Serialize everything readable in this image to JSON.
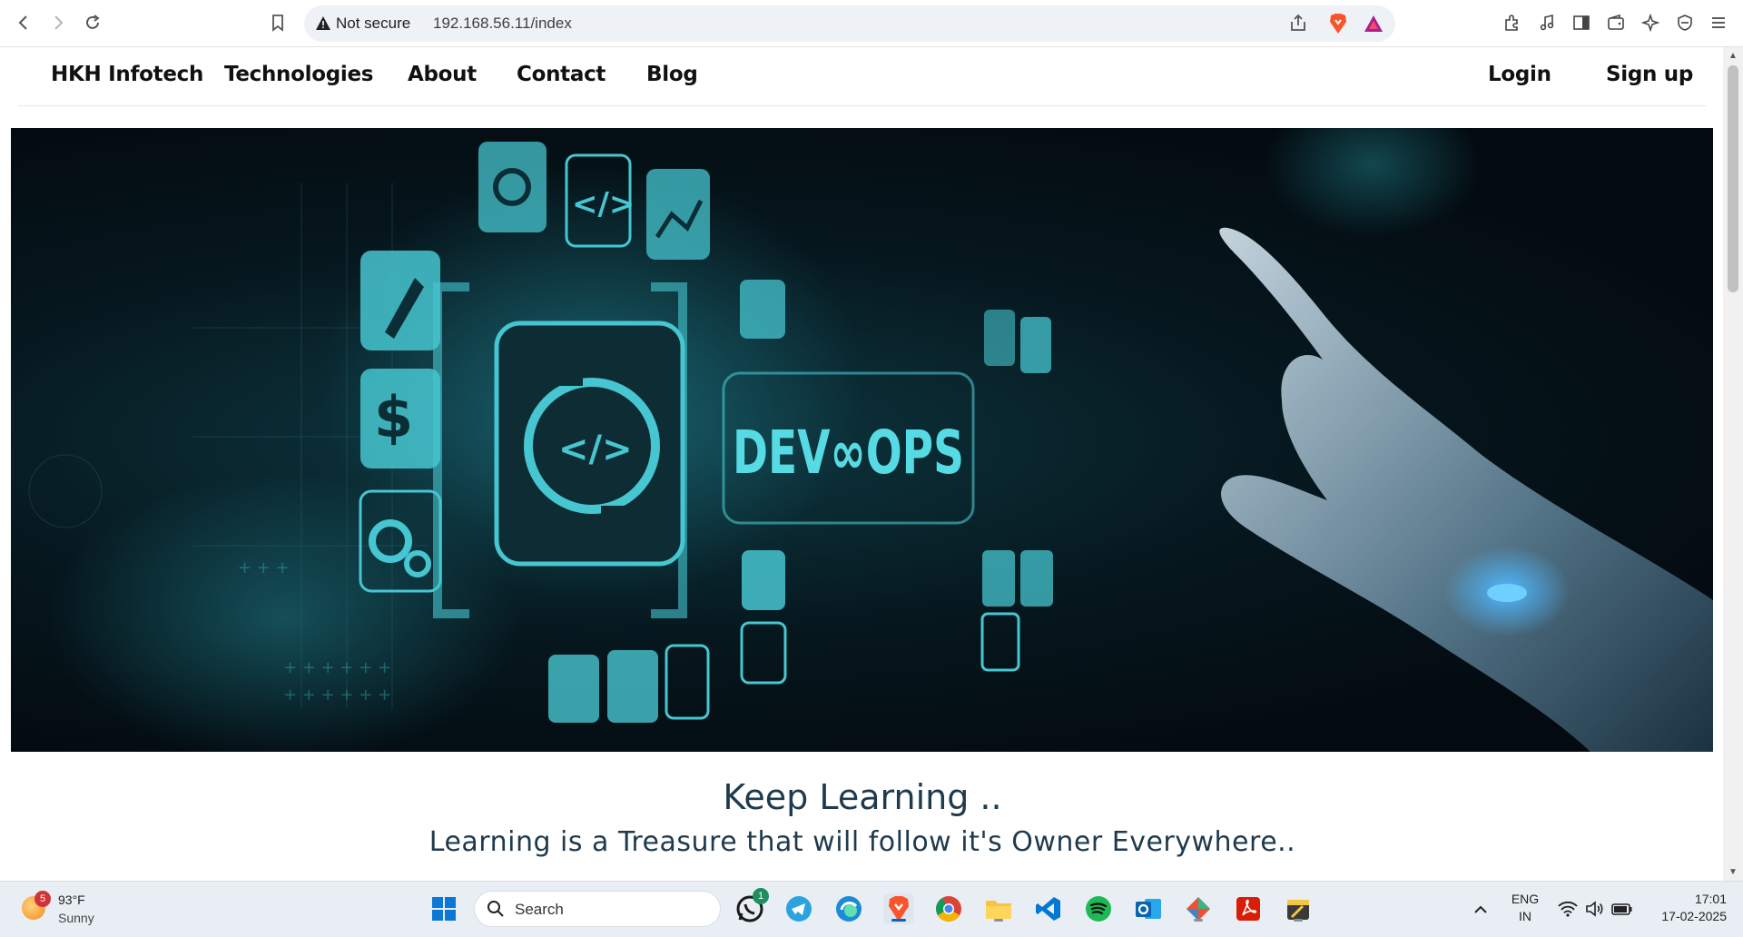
{
  "browser": {
    "security_label": "Not secure",
    "url": "192.168.56.11/index"
  },
  "site_nav": {
    "brand": "HKH Infotech",
    "links": [
      "Technologies",
      "About",
      "Contact",
      "Blog"
    ],
    "login": "Login",
    "signup": "Sign up"
  },
  "hero": {
    "banner_text": "DEV∞OPS",
    "icons": [
      "gears-icon",
      "code-icon",
      "chart-icon",
      "rocket-icon",
      "dollar-icon",
      "settings-icon",
      "monitor-icon",
      "bulb-icon",
      "team-icon",
      "tools-icon",
      "document-icon",
      "refresh-icon"
    ]
  },
  "tagline": {
    "title": "Keep Learning ..",
    "subtitle": "Learning is a Treasure that will follow it's Owner Everywhere.."
  },
  "taskbar": {
    "weather_badge": "5",
    "weather_temp": "93°F",
    "weather_cond": "Sunny",
    "search_label": "Search",
    "whatsapp_badge": "1",
    "lang_top": "ENG",
    "lang_bottom": "IN",
    "time": "17:01",
    "date": "17-02-2025"
  },
  "colors": {
    "accent_cyan": "#3fd4e0",
    "heading_text": "#1f3a4d",
    "taskbar_bg": "#e9eef5"
  }
}
